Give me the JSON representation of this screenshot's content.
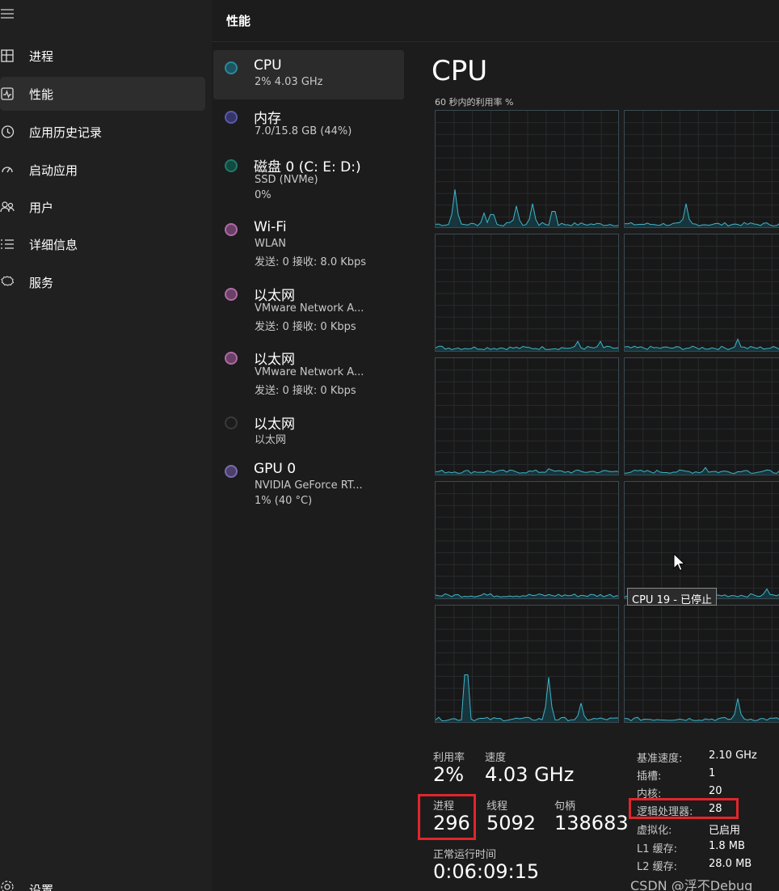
{
  "nav": {
    "items": [
      {
        "label": "进程",
        "icon": "processes-icon"
      },
      {
        "label": "性能",
        "icon": "performance-icon"
      },
      {
        "label": "应用历史记录",
        "icon": "app-history-icon"
      },
      {
        "label": "启动应用",
        "icon": "startup-apps-icon"
      },
      {
        "label": "用户",
        "icon": "users-icon"
      },
      {
        "label": "详细信息",
        "icon": "details-icon"
      },
      {
        "label": "服务",
        "icon": "services-icon"
      }
    ],
    "settings_label": "设置"
  },
  "header": {
    "title": "性能"
  },
  "devices": [
    {
      "name": "CPU",
      "lines": [
        "2% 4.03 GHz"
      ],
      "color": "#2a8a9a"
    },
    {
      "name": "内存",
      "lines": [
        "7.0/15.8 GB (44%)"
      ],
      "color": "#5a5ab0"
    },
    {
      "name": "磁盘 0 (C: E: D:)",
      "lines": [
        "SSD (NVMe)",
        "0%"
      ],
      "color": "#1f7a6a"
    },
    {
      "name": "Wi-Fi",
      "lines": [
        "WLAN",
        "发送: 0 接收: 8.0 Kbps"
      ],
      "color": "#b06aa8"
    },
    {
      "name": "以太网",
      "lines": [
        "VMware Network A...",
        "发送: 0 接收: 0 Kbps"
      ],
      "color": "#b06aa8"
    },
    {
      "name": "以太网",
      "lines": [
        "VMware Network A...",
        "发送: 0 接收: 0 Kbps"
      ],
      "color": "#b06aa8"
    },
    {
      "name": "以太网",
      "lines": [
        "以太网"
      ],
      "color": "#3a3a3a"
    },
    {
      "name": "GPU 0",
      "lines": [
        "NVIDIA GeForce RT...",
        "1% (40 °C)"
      ],
      "color": "#7a6ab0"
    }
  ],
  "cpu": {
    "title": "CPU",
    "graph_caption": "60 秒内的利用率 %",
    "tooltip": "CPU 19 - 已停止",
    "stats": {
      "utilization_label": "利用率",
      "utilization_value": "2%",
      "speed_label": "速度",
      "speed_value": "4.03 GHz",
      "processes_label": "进程",
      "processes_value": "296",
      "threads_label": "线程",
      "threads_value": "5092",
      "handles_label": "句柄",
      "handles_value": "138683",
      "uptime_label": "正常运行时间",
      "uptime_value": "0:06:09:15"
    },
    "info": [
      {
        "key": "基准速度:",
        "value": "2.10 GHz"
      },
      {
        "key": "插槽:",
        "value": "1"
      },
      {
        "key": "内核:",
        "value": "20"
      },
      {
        "key": "逻辑处理器:",
        "value": "28"
      },
      {
        "key": "虚拟化:",
        "value": "已启用"
      },
      {
        "key": "L1 缓存:",
        "value": "1.8 MB"
      },
      {
        "key": "L2 缓存:",
        "value": "28.0 MB"
      }
    ]
  },
  "colors": {
    "accent": "#41b4c8",
    "highlight_box": "#e0262b"
  },
  "watermark": "CSDN @浮不Debug"
}
